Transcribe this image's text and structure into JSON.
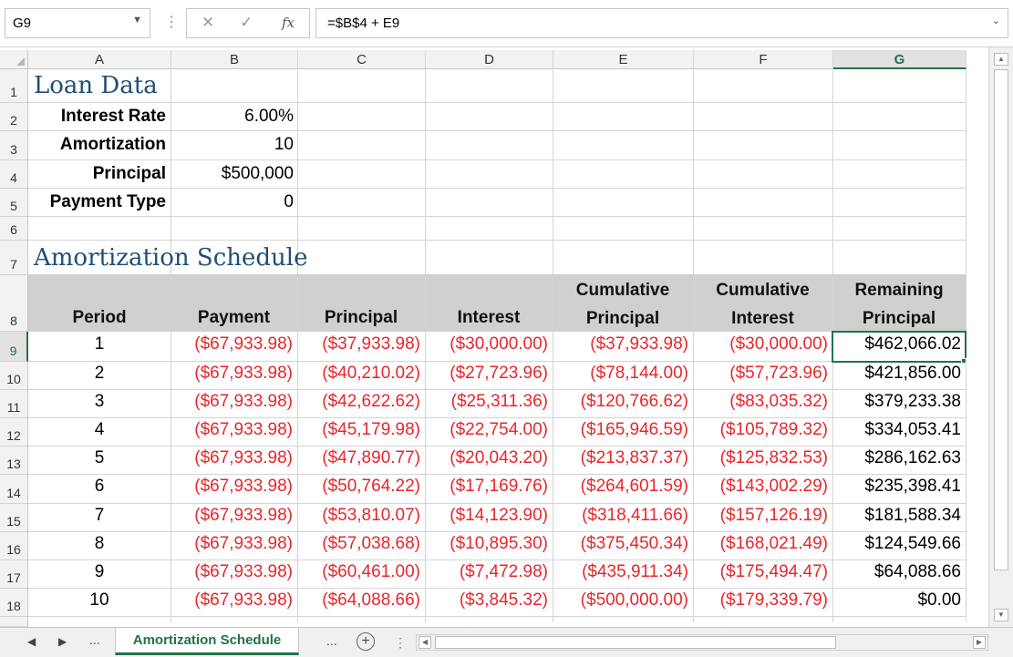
{
  "formula_bar": {
    "name_box": "G9",
    "cancel_glyph": "✕",
    "enter_glyph": "✓",
    "fx_label": "fx",
    "formula": "=$B$4 + E9"
  },
  "columns": [
    "A",
    "B",
    "C",
    "D",
    "E",
    "F",
    "G"
  ],
  "rows": [
    "1",
    "2",
    "3",
    "4",
    "5",
    "6",
    "7",
    "8",
    "9",
    "10",
    "11",
    "12",
    "13",
    "14",
    "15",
    "16",
    "17",
    "18"
  ],
  "loan": {
    "title": "Loan Data",
    "interest_rate_label": "Interest Rate",
    "interest_rate_value": "6.00%",
    "amortization_label": "Amortization",
    "amortization_value": "10",
    "principal_label": "Principal",
    "principal_value": "$500,000",
    "payment_type_label": "Payment Type",
    "payment_type_value": "0"
  },
  "schedule": {
    "title": "Amortization Schedule",
    "headers": {
      "period": "Period",
      "payment": "Payment",
      "principal": "Principal",
      "interest": "Interest",
      "cum_principal_1": "Cumulative",
      "cum_principal_2": "Principal",
      "cum_interest_1": "Cumulative",
      "cum_interest_2": "Interest",
      "remaining_1": "Remaining",
      "remaining_2": "Principal"
    },
    "rows": [
      {
        "period": "1",
        "payment": "($67,933.98)",
        "principal": "($37,933.98)",
        "interest": "($30,000.00)",
        "cum_principal": "($37,933.98)",
        "cum_interest": "($30,000.00)",
        "remaining": "$462,066.02"
      },
      {
        "period": "2",
        "payment": "($67,933.98)",
        "principal": "($40,210.02)",
        "interest": "($27,723.96)",
        "cum_principal": "($78,144.00)",
        "cum_interest": "($57,723.96)",
        "remaining": "$421,856.00"
      },
      {
        "period": "3",
        "payment": "($67,933.98)",
        "principal": "($42,622.62)",
        "interest": "($25,311.36)",
        "cum_principal": "($120,766.62)",
        "cum_interest": "($83,035.32)",
        "remaining": "$379,233.38"
      },
      {
        "period": "4",
        "payment": "($67,933.98)",
        "principal": "($45,179.98)",
        "interest": "($22,754.00)",
        "cum_principal": "($165,946.59)",
        "cum_interest": "($105,789.32)",
        "remaining": "$334,053.41"
      },
      {
        "period": "5",
        "payment": "($67,933.98)",
        "principal": "($47,890.77)",
        "interest": "($20,043.20)",
        "cum_principal": "($213,837.37)",
        "cum_interest": "($125,832.53)",
        "remaining": "$286,162.63"
      },
      {
        "period": "6",
        "payment": "($67,933.98)",
        "principal": "($50,764.22)",
        "interest": "($17,169.76)",
        "cum_principal": "($264,601.59)",
        "cum_interest": "($143,002.29)",
        "remaining": "$235,398.41"
      },
      {
        "period": "7",
        "payment": "($67,933.98)",
        "principal": "($53,810.07)",
        "interest": "($14,123.90)",
        "cum_principal": "($318,411.66)",
        "cum_interest": "($157,126.19)",
        "remaining": "$181,588.34"
      },
      {
        "period": "8",
        "payment": "($67,933.98)",
        "principal": "($57,038.68)",
        "interest": "($10,895.30)",
        "cum_principal": "($375,450.34)",
        "cum_interest": "($168,021.49)",
        "remaining": "$124,549.66"
      },
      {
        "period": "9",
        "payment": "($67,933.98)",
        "principal": "($60,461.00)",
        "interest": "($7,472.98)",
        "cum_principal": "($435,911.34)",
        "cum_interest": "($175,494.47)",
        "remaining": "$64,088.66"
      },
      {
        "period": "10",
        "payment": "($67,933.98)",
        "principal": "($64,088.66)",
        "interest": "($3,845.32)",
        "cum_principal": "($500,000.00)",
        "cum_interest": "($179,339.79)",
        "remaining": "$0.00"
      }
    ]
  },
  "sheet_tabs": {
    "prev": "◀",
    "next": "▶",
    "ellipsis_left": "...",
    "active_tab": "Amortization Schedule",
    "ellipsis_right": "...",
    "add": "+"
  },
  "colors": {
    "accent_green": "#217346",
    "negative_red": "#e8262b",
    "title_blue": "#1f4e79",
    "header_band_gray": "#d0d0d0"
  },
  "icons": [
    "name-box-dropdown-icon",
    "cancel-icon",
    "enter-icon",
    "function-icon",
    "formula-expand-icon",
    "add-sheet-icon"
  ]
}
